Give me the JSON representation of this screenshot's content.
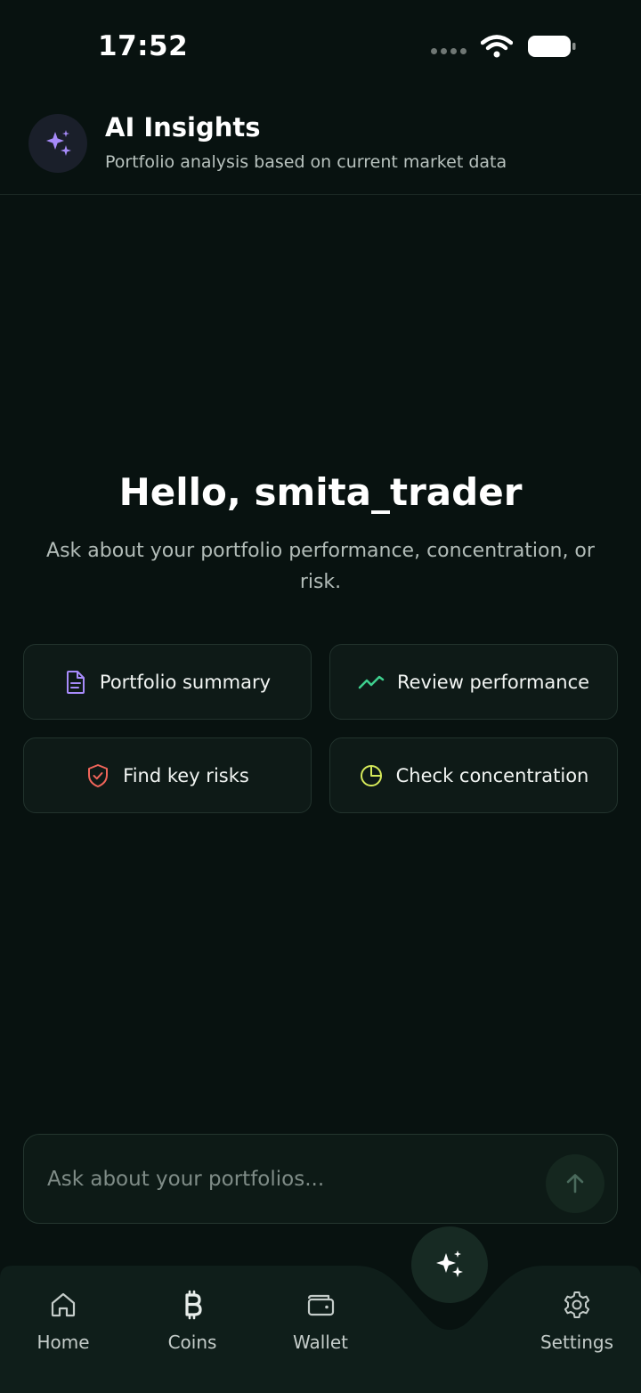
{
  "status_bar": {
    "time": "17:52"
  },
  "header": {
    "title": "AI Insights",
    "subtitle": "Portfolio analysis based on current market data",
    "icon": "sparkles-icon"
  },
  "greeting": {
    "title": "Hello, smita_trader",
    "subtitle": "Ask about your portfolio performance, concentration, or risk."
  },
  "suggestions": [
    {
      "label": "Portfolio summary",
      "icon": "document-icon",
      "color": "#a78bfa"
    },
    {
      "label": "Review performance",
      "icon": "trend-line-icon",
      "color": "#3ecf8e"
    },
    {
      "label": "Find key risks",
      "icon": "shield-check-icon",
      "color": "#f0655a"
    },
    {
      "label": "Check concentration",
      "icon": "pie-chart-icon",
      "color": "#d6ea5a"
    }
  ],
  "composer": {
    "placeholder": "Ask about your portfolios...",
    "send_icon": "arrow-up-icon"
  },
  "nav": {
    "items": [
      {
        "label": "Home",
        "icon": "home-icon"
      },
      {
        "label": "Coins",
        "icon": "bitcoin-icon"
      },
      {
        "label": "Wallet",
        "icon": "wallet-icon"
      },
      {
        "label": "Settings",
        "icon": "gear-icon"
      }
    ],
    "center_icon": "sparkles-icon"
  }
}
